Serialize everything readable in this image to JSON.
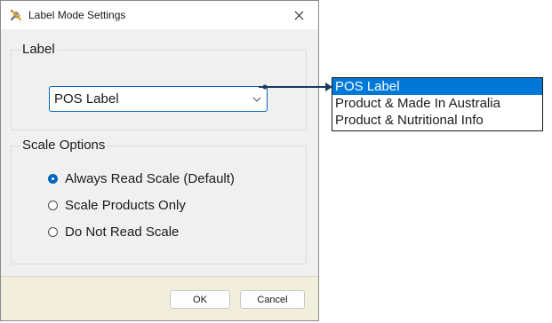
{
  "window": {
    "title": "Label Mode Settings"
  },
  "label_group": {
    "title": "Label",
    "combo_value": "POS Label"
  },
  "scale_group": {
    "title": "Scale Options",
    "options": [
      {
        "label": "Always Read Scale (Default)",
        "checked": true
      },
      {
        "label": "Scale Products Only",
        "checked": false
      },
      {
        "label": "Do Not Read Scale",
        "checked": false
      }
    ]
  },
  "buttons": {
    "ok": "OK",
    "cancel": "Cancel"
  },
  "dropdown_list": {
    "items": [
      "POS Label",
      "Product & Made In Australia",
      "Product & Nutritional Info"
    ],
    "selected_index": 0
  },
  "colors": {
    "accent": "#0067c0",
    "selection": "#0078d7",
    "footer": "#f1efdc"
  }
}
